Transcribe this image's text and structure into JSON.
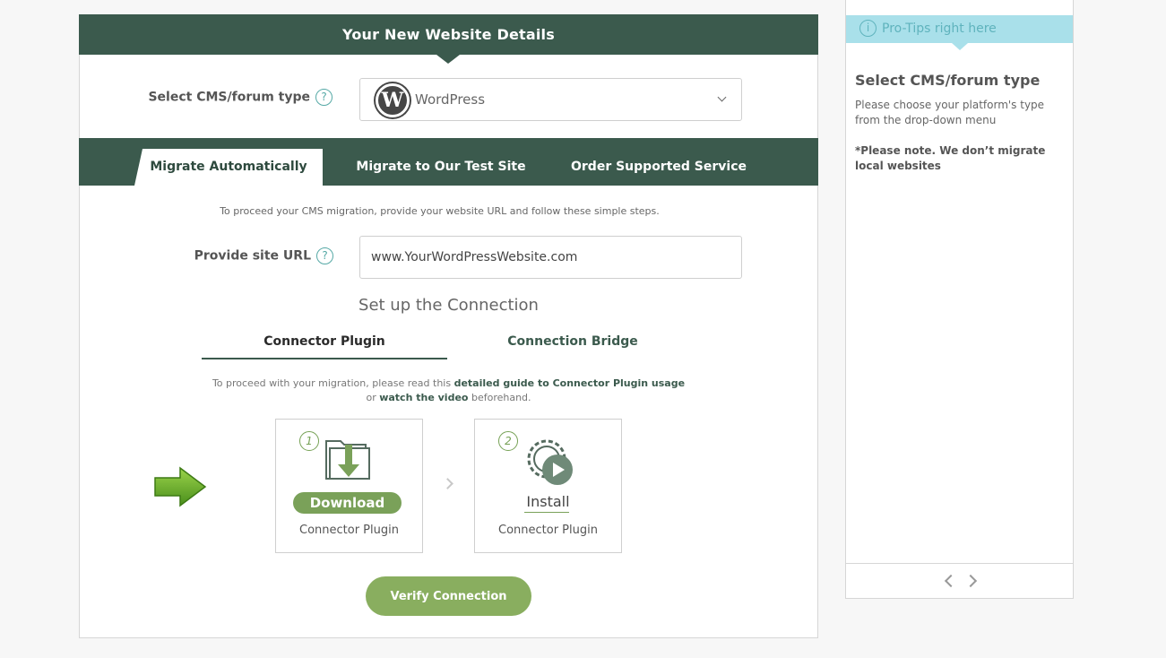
{
  "header": {
    "title": "Your New Website Details"
  },
  "cms": {
    "label": "Select CMS/forum type",
    "help": "?",
    "selected": "WordPress",
    "logo_letter": "W"
  },
  "tabs": [
    {
      "label": "Migrate Automatically",
      "active": true
    },
    {
      "label": "Migrate to Our Test Site",
      "active": false
    },
    {
      "label": "Order Supported Service",
      "active": false
    }
  ],
  "intro_text": "To proceed your CMS migration, provide your website URL and follow these simple steps.",
  "site_url": {
    "label": "Provide site URL",
    "help": "?",
    "value": "www.YourWordPressWebsite.com"
  },
  "connection": {
    "title": "Set up the Connection",
    "sub_tabs": [
      {
        "label": "Connector Plugin",
        "active": true
      },
      {
        "label": "Connection Bridge",
        "active": false
      }
    ],
    "guide_prefix": "To proceed with your migration, please read this ",
    "guide_link": "detailed guide to Connector Plugin usage",
    "guide_mid": "or ",
    "video_link": "watch the video",
    "guide_suffix": " beforehand."
  },
  "steps": [
    {
      "number": "1",
      "action": "Download",
      "caption": "Connector Plugin"
    },
    {
      "number": "2",
      "action": "Install",
      "caption": "Connector Plugin"
    }
  ],
  "verify_label": "Verify Connection",
  "side_panel": {
    "header": "Pro-Tips right here",
    "info_glyph": "i",
    "title": "Select CMS/forum type",
    "body": "Please choose your platform's type from the drop-down menu",
    "note": "*Please note. We don’t migrate local websites"
  },
  "colors": {
    "header_green": "#3b5a4d",
    "button_green": "#89ae5f",
    "pro_tips_bg": "#a9e0ea",
    "help_teal": "#56a9a6"
  },
  "icons": [
    "wordpress-logo-icon",
    "help-icon",
    "chevron-down-icon",
    "arrow-right-icon",
    "folder-download-icon",
    "gear-play-icon",
    "info-icon",
    "chevron-left-icon",
    "chevron-right-icon"
  ]
}
